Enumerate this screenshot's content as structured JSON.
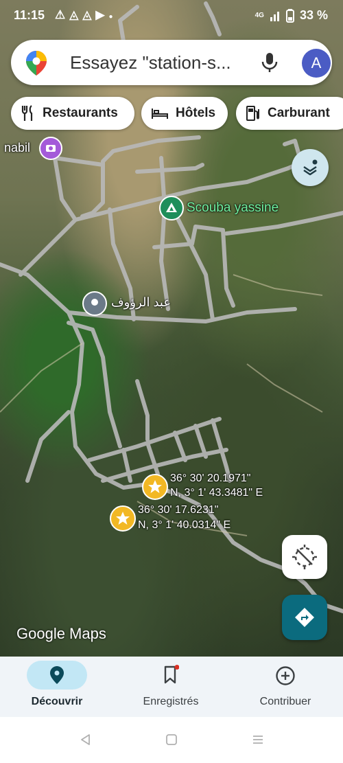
{
  "status_bar": {
    "time": "11:15",
    "notification_icons": [
      "warning-icon",
      "app-icon",
      "app-icon",
      "youtube-icon",
      "dot"
    ],
    "network": "4G",
    "battery": "33 %"
  },
  "search": {
    "placeholder": "Essayez \"station-s...",
    "avatar_letter": "A"
  },
  "chips": [
    {
      "label": "Restaurants",
      "icon": "fork-knife-icon"
    },
    {
      "label": "Hôtels",
      "icon": "bed-icon"
    },
    {
      "label": "Carburant",
      "icon": "fuel-icon"
    }
  ],
  "map_labels": {
    "nabil": "nabil",
    "scouba": "Scouba yassine",
    "abderraouf": "عبد الرؤوف",
    "pin1_line1": "36° 30' 20.1971\"",
    "pin1_line2": "N, 3° 1' 43.3481\" E",
    "pin2_line1": "36° 30' 17.6231\"",
    "pin2_line2": "N, 3° 1' 40.0314\" E"
  },
  "watermark": "Google Maps",
  "bottom_nav": [
    {
      "label": "Découvrir",
      "icon": "location-pin-icon",
      "active": true
    },
    {
      "label": "Enregistrés",
      "icon": "bookmark-icon",
      "active": false
    },
    {
      "label": "Contribuer",
      "icon": "add-circle-icon",
      "active": false
    }
  ],
  "colors": {
    "accent": "#0b6b7e",
    "active_pill": "#c2e7f5",
    "avatar": "#4b5cc4",
    "star_pin": "#f2b824"
  }
}
